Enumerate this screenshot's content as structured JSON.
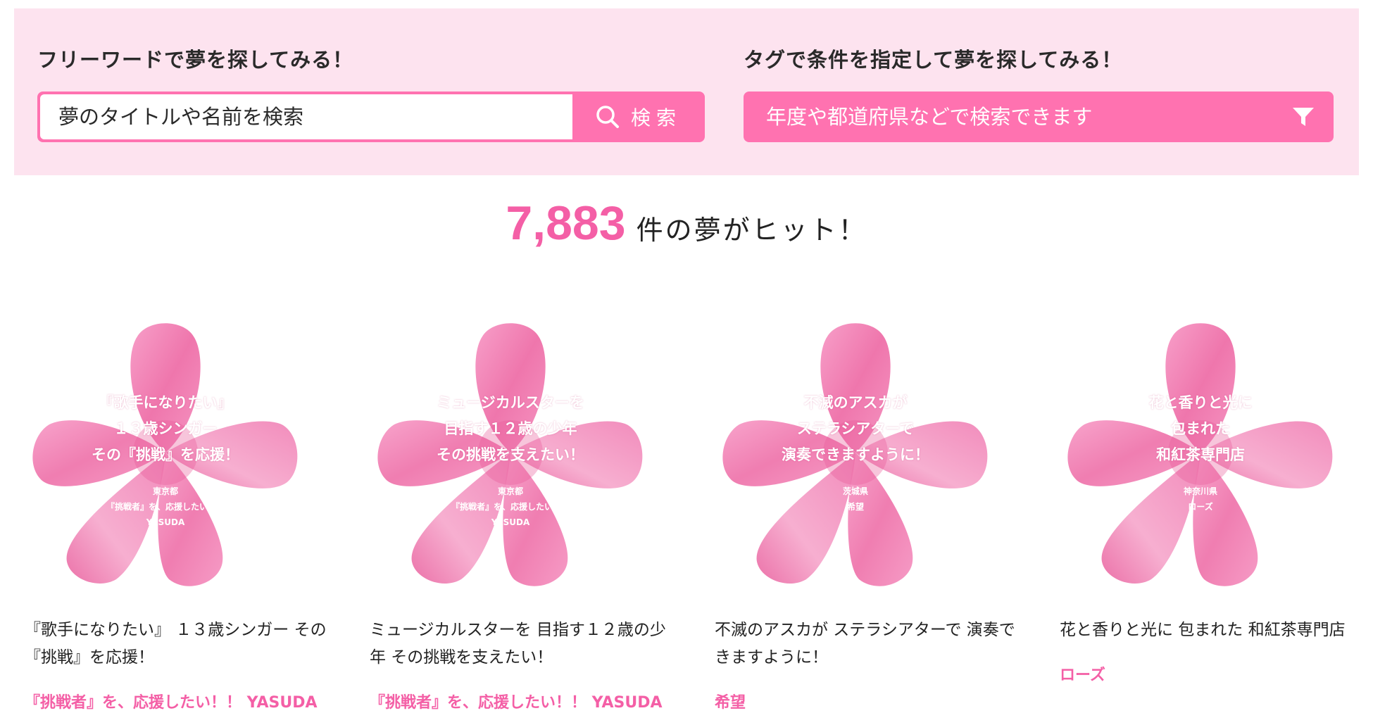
{
  "search": {
    "keyword_heading": "フリーワードで夢を探してみる！",
    "keyword_value": "夢のタイトルや名前を検索",
    "search_button_label": "検索",
    "tag_heading": "タグで条件を指定して夢を探してみる！",
    "tag_placeholder": "年度や都道府県などで検索できます"
  },
  "results": {
    "count": "7,883",
    "suffix": "件の夢がヒット！"
  },
  "colors": {
    "accent": "#ff72b0",
    "accent_text": "#f45fa6",
    "panel_bg": "#fde3ef"
  },
  "cards": [
    {
      "flower_title": "『歌手になりたい』\n１３歳シンガー\nその『挑戦』を応援！",
      "prefecture": "東京都",
      "supporter": "『挑戦者』を、応援したい！！",
      "supporter_name": "YASUDA",
      "title": "『歌手になりたい』 １３歳シンガー その『挑戦』を応援！",
      "author": "『挑戦者』を、応援したい！！ YASUDA"
    },
    {
      "flower_title": "ミュージカルスターを\n目指す１２歳の少年\nその挑戦を支えたい！",
      "prefecture": "東京都",
      "supporter": "『挑戦者』を、応援したい！！",
      "supporter_name": "YASUDA",
      "title": "ミュージカルスターを 目指す１２歳の少年 その挑戦を支えたい！",
      "author": "『挑戦者』を、応援したい！！ YASUDA"
    },
    {
      "flower_title": "不滅のアスカが\nステラシアターで\n演奏できますように！",
      "prefecture": "茨城県",
      "supporter": "希望",
      "supporter_name": "",
      "title": "不滅のアスカが ステラシアターで 演奏できますように！",
      "author": "希望"
    },
    {
      "flower_title": "花と香りと光に\n包まれた\n和紅茶専門店",
      "prefecture": "神奈川県",
      "supporter": "ローズ",
      "supporter_name": "",
      "title": "花と香りと光に 包まれた 和紅茶専門店",
      "author": "ローズ"
    }
  ]
}
